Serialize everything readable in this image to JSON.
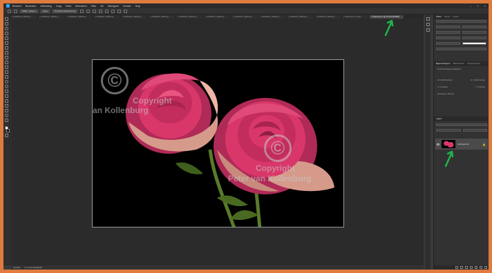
{
  "app": {
    "menu": [
      "Bestand",
      "Bewerken",
      "Afbeelding",
      "Laag",
      "Tekst",
      "Selecteren",
      "Filter",
      "3D",
      "Weergave",
      "Venster",
      "Help"
    ]
  },
  "options_bar": {
    "sample_label": "Malen: laderen",
    "size_value": "Laag",
    "transform_label": "Transformatiebesturing"
  },
  "tabs": [
    {
      "label": "× 20190207_98454.jp...",
      "active": false
    },
    {
      "label": "× 20190207_98454.jp...",
      "active": false
    },
    {
      "label": "× 20190207_98454.jp...",
      "active": false
    },
    {
      "label": "× 20190207_98454.jp...",
      "active": false
    },
    {
      "label": "× 20190207_98454.jp...",
      "active": false
    },
    {
      "label": "× 20190207_98454.jp...",
      "active": false
    },
    {
      "label": "× 20190207_98454.jp...",
      "active": false
    },
    {
      "label": "× 20190207_98454.jp...",
      "active": false
    },
    {
      "label": "× 20190207_98454.jp...",
      "active": false
    },
    {
      "label": "× 20190207_98454.jp...",
      "active": false
    },
    {
      "label": "× 20190207_98454.jp...",
      "active": false
    },
    {
      "label": "× 20190207_98454.jp...",
      "active": false
    },
    {
      "label": "× Naamloos-1 @ 50...",
      "active": false
    },
    {
      "label": "× Naamloos-2 @ 33,3% (RGB/8)",
      "active": true
    }
  ],
  "canvas": {
    "watermark_line1": "Copyright",
    "watermark_line2": "Peter van Kollenburg",
    "copyright_symbol": "©"
  },
  "status": {
    "zoom": "33,33%",
    "doc_info": "3 x 2 bits 96,68,9/8"
  },
  "panels": {
    "character_tabs": [
      "Teken",
      "Alinea",
      "Glyfen"
    ],
    "properties_tabs": [
      "Eigenschappen",
      "Bibliotheken",
      "Aanpassingen"
    ],
    "properties_title": "Documenteigenschappen",
    "prop_w": "W: 29,63 inches",
    "prop_h": "H: 19,69 inches",
    "prop_x": "X: 0 inches",
    "prop_y": "Y: 0 inches",
    "resolution": "Resolutie: 300 ppi",
    "layers_title": "Lagen",
    "layer_name": "Achtergrond"
  },
  "colors": {
    "frame": "#e07b3f",
    "accent_arrow": "#1fb54a",
    "rose": "#d9376a"
  }
}
